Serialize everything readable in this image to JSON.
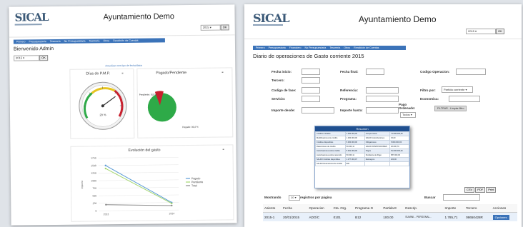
{
  "colors": {
    "accent": "#3b73b9",
    "green": "#2eaa48",
    "red": "#c8202e",
    "pagado": "#5b9bd5",
    "pendiente": "#a4d66f",
    "total": "#888888"
  },
  "window1": {
    "logo": "SICAL",
    "app_title": "Ayuntamiento Demo",
    "year": "2015",
    "ok": "OK",
    "nav": [
      "Primero",
      "Presupuestaria",
      "Tesorería",
      "No Presupuestaria",
      "Tesorería",
      "Otros",
      "Rendición de Cuentas"
    ],
    "welcome": "Bienvenido Admin",
    "small_year": "2015",
    "small_ok": "OK",
    "link_text": "Actualizar mes tipo de fecha/datos",
    "gauge_title": "Días de P.M.P.",
    "gauge_value_label": "20 %",
    "gauge_value": 0.7,
    "pie_title": "Pagado/Pendiente",
    "pie_pendiente_label": "Pendiente: 9,8 %",
    "pie_pagado_label": "Pagado: 90,2 %",
    "pie_pendiente_fraction": 0.098,
    "chart_title": "Evolución del gasto",
    "legend": [
      "Pagado",
      "Pendiente",
      "Total"
    ]
  },
  "chart_data": {
    "type": "line",
    "title": "Evolución del gasto",
    "x": [
      "2013",
      "2014"
    ],
    "series": [
      {
        "name": "Pagado",
        "values": [
          1500,
          250
        ]
      },
      {
        "name": "Pendiente",
        "values": [
          1400,
          220
        ]
      },
      {
        "name": "Total",
        "values": [
          200,
          150
        ]
      }
    ],
    "ylim": [
      0,
      1750
    ],
    "yticks": [
      0,
      250,
      500,
      750,
      1000,
      1250,
      1500,
      1750
    ],
    "ylabel": "Importe"
  },
  "window2": {
    "logo": "SICAL",
    "app_title": "Ayuntamiento Demo",
    "year": "2015",
    "ok": "OK",
    "nav": [
      "Primero",
      "Presupuestaria",
      "Financiero",
      "No Presupuestaria",
      "Tesorería",
      "Otros",
      "Rendición de Cuentas"
    ],
    "page_title": "Diario de operaciones de Gasto corriente 2015",
    "filters": {
      "fecha_inicio": "Fecha inicio:",
      "fecha_final": "Fecha final:",
      "codigo_operacion": "Codigo Operacion:",
      "tercero": "Tercero:",
      "codigo_fase": "Codigo de fase:",
      "referencia": "Referencia:",
      "filtro_por": "Filtro por:",
      "filtro_valor": "Partida corriente",
      "servicio": "Servicio:",
      "programa": "Programa:",
      "economica": "Economica:",
      "importe_desde": "Importe desde:",
      "importe_hasta": "Importe hasta:",
      "pago_ordenado": "Pago Ordenado:",
      "pago_valor": "Todos",
      "filtrar_btn": "FILTRAR - Limpiar filtro"
    },
    "resumen": {
      "title": "Resumen",
      "rows": [
        [
          "Créditos iniciales",
          "1.000.000,00",
          "Compromisos",
          "71.000.000,00"
        ],
        [
          "Modificaciones de crédito",
          "1.000.000,00",
          "SALDO Autorizaciones",
          "15,00"
        ],
        [
          "Créditos disponibles",
          "5.000.000,00",
          "Obligaciones",
          "5.000.000,00"
        ],
        [
          "Retenciones de crédito",
          "50.000,11",
          "SALDO DISPOSICIONES",
          "26.000,70"
        ],
        [
          "Autorizaciones sobre crédito",
          "5.001.000,00",
          "Pagos",
          "51.000.000,00"
        ],
        [
          "Autorizaciones sobre retención",
          "50.000,11",
          "Pendiente de Pago",
          "587.000,00"
        ],
        [
          "SALDO Créditos disponibles",
          "1.277.000,07",
          "Reintegros",
          "200,00"
        ],
        [
          "SALDO Retenciones de crédito",
          "800",
          "",
          ""
        ]
      ]
    },
    "export": [
      "CSV",
      "PDF",
      "Print"
    ],
    "mostrando": "Mostrando",
    "per_page": "10",
    "registros": "registros por página",
    "buscar": "Buscar",
    "columns": [
      "Asiento",
      "Fecha",
      "Operacion",
      "Cta. Org.",
      "Programa G",
      "Partida E",
      "Descrip.",
      "Importe",
      "Tercero",
      "Acciones"
    ],
    "row": [
      "2015-1",
      "20/01/2015",
      "ADO/C",
      "0101",
      "B12",
      "100.00",
      "SUMINI... PERSONAL...",
      "1.785,71",
      "08650428R",
      "Opciones"
    ]
  }
}
